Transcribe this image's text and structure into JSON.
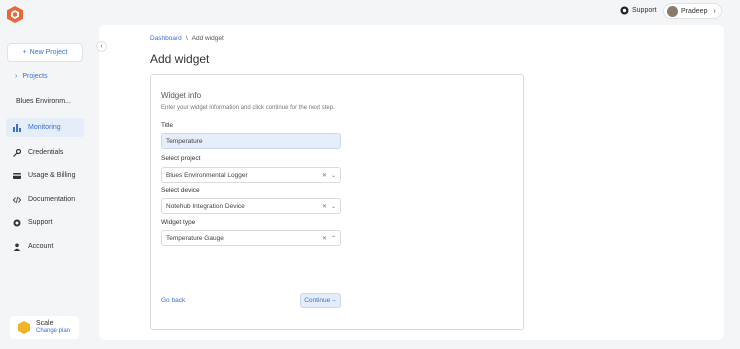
{
  "sidebar": {
    "new_project_label": "New Project",
    "projects_label": "Projects",
    "project_name": "Blues Environm...",
    "items": [
      {
        "label": "Monitoring"
      },
      {
        "label": "Credentials"
      },
      {
        "label": "Usage & Billing"
      },
      {
        "label": "Documentation"
      },
      {
        "label": "Support"
      },
      {
        "label": "Account"
      }
    ],
    "plan": {
      "name": "Scale",
      "action": "Change plan"
    }
  },
  "topbar": {
    "support_label": "Support",
    "user_name": "Pradeep"
  },
  "breadcrumb": {
    "root": "Dashboard",
    "separator": "\\",
    "current": "Add widget"
  },
  "page_title": "Add widget",
  "form": {
    "title": "Widget info",
    "description": "Enter your widget information and click continue for the next step.",
    "title_label": "Title",
    "title_value": "Temperature",
    "project_label": "Select project",
    "project_value": "Blues Environmental Logger",
    "device_label": "Select device",
    "device_value": "Notehub Integration Device",
    "type_label": "Widget type",
    "type_value": "Temperature Gauge",
    "go_back": "Go back",
    "continue": "Continue"
  },
  "colors": {
    "accent": "#3b6fd6",
    "active_bg": "#e4edf9",
    "logo": "#e8683a",
    "plan_badge": "#f0b429"
  }
}
